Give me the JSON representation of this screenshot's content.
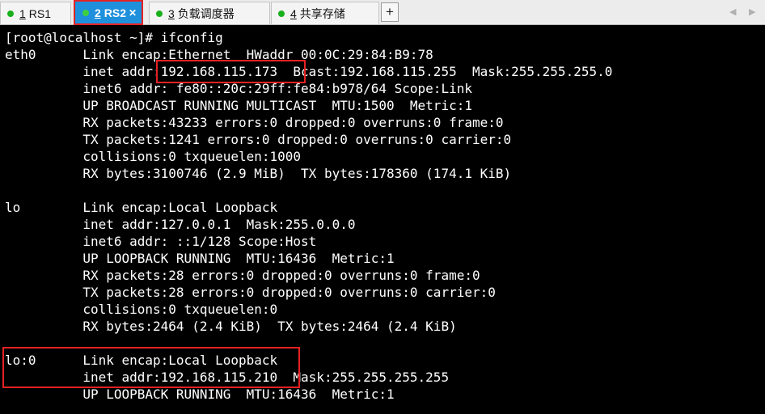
{
  "tabs": [
    {
      "num": "1",
      "label": "RS1",
      "active": false
    },
    {
      "num": "2",
      "label": "RS2",
      "active": true
    },
    {
      "num": "3",
      "label": "负载调度器",
      "active": false
    },
    {
      "num": "4",
      "label": "共享存储",
      "active": false
    }
  ],
  "icons": {
    "status_dot": "green-dot-icon",
    "close": "close-icon",
    "add": "plus-icon",
    "prev": "chevron-left-icon",
    "next": "chevron-right-icon"
  },
  "colors": {
    "active_tab": "#1e90dc",
    "highlight": "#e52222",
    "status_dot": "#19b01c"
  },
  "terminal": {
    "lines": [
      "[root@localhost ~]# ifconfig",
      "eth0      Link encap:Ethernet  HWaddr 00:0C:29:84:B9:78",
      "          inet addr:192.168.115.173  Bcast:192.168.115.255  Mask:255.255.255.0",
      "          inet6 addr: fe80::20c:29ff:fe84:b978/64 Scope:Link",
      "          UP BROADCAST RUNNING MULTICAST  MTU:1500  Metric:1",
      "          RX packets:43233 errors:0 dropped:0 overruns:0 frame:0",
      "          TX packets:1241 errors:0 dropped:0 overruns:0 carrier:0",
      "          collisions:0 txqueuelen:1000",
      "          RX bytes:3100746 (2.9 MiB)  TX bytes:178360 (174.1 KiB)",
      "",
      "lo        Link encap:Local Loopback",
      "          inet addr:127.0.0.1  Mask:255.0.0.0",
      "          inet6 addr: ::1/128 Scope:Host",
      "          UP LOOPBACK RUNNING  MTU:16436  Metric:1",
      "          RX packets:28 errors:0 dropped:0 overruns:0 frame:0",
      "          TX packets:28 errors:0 dropped:0 overruns:0 carrier:0",
      "          collisions:0 txqueuelen:0",
      "          RX bytes:2464 (2.4 KiB)  TX bytes:2464 (2.4 KiB)",
      "",
      "lo:0      Link encap:Local Loopback",
      "          inet addr:192.168.115.210  Mask:255.255.255.255",
      "          UP LOOPBACK RUNNING  MTU:16436  Metric:1"
    ]
  }
}
